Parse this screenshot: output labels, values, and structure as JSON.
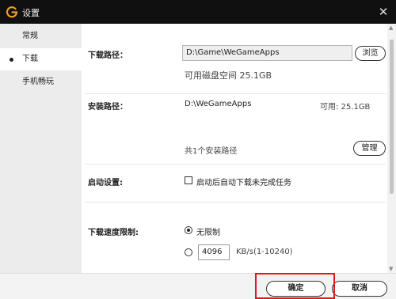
{
  "window": {
    "title": "设置"
  },
  "sidebar": {
    "items": [
      {
        "label": "常规"
      },
      {
        "label": "下载"
      },
      {
        "label": "手机畅玩"
      }
    ]
  },
  "download_path": {
    "label": "下载路径：",
    "value": "D:\\Game\\WeGameApps",
    "browse_label": "浏览",
    "free_space": "可用磁盘空间 25.1GB"
  },
  "install_path": {
    "label": "安装路径：",
    "path": "D:\\WeGameApps",
    "free": "可用: 25.1GB",
    "count": "共1个安装路径",
    "manage_label": "管理"
  },
  "startup": {
    "label": "启动设置:",
    "option": "启动后自动下载未完成任务"
  },
  "speed_limit": {
    "label": "下载速度限制:",
    "unlimited": "无限制",
    "value": "4096",
    "unit": "KB/s(1-10240)"
  },
  "footer": {
    "ok_label": "确定",
    "cancel_label": "取消"
  },
  "colors": {
    "titlebar": "#101010",
    "logo": "#f0a020",
    "highlight": "#e01818"
  }
}
